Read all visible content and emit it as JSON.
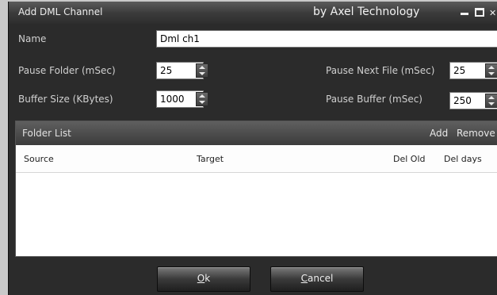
{
  "window": {
    "title": "Add DML Channel",
    "brand": "by Axel Technology"
  },
  "form": {
    "name_label": "Name",
    "name_value": "Dml ch1",
    "pause_folder_label": "Pause Folder (mSec)",
    "pause_folder_value": "25",
    "buffer_size_label": "Buffer Size (KBytes)",
    "buffer_size_value": "1000",
    "pause_next_file_label": "Pause Next File (mSec)",
    "pause_next_file_value": "25",
    "pause_buffer_label": "Pause Buffer (mSec)",
    "pause_buffer_value": "250"
  },
  "folder_list": {
    "title": "Folder List",
    "add_label": "Add",
    "remove_label": "Remove",
    "columns": [
      "Source",
      "Target",
      "Del Old",
      "Del days"
    ],
    "rows": []
  },
  "buttons": {
    "ok_mnemonic": "O",
    "ok_rest": "k",
    "cancel_mnemonic": "C",
    "cancel_rest": "ancel"
  },
  "icons": {
    "minimize": "minimize-icon",
    "maximize": "maximize-icon",
    "close": "close-icon",
    "spinner": "spinner-icon"
  },
  "colors": {
    "window_bg": "#2b2b2b",
    "titlebar": "#3c3c3c",
    "label_text": "#d0d0d0",
    "page_bg": "#c9c9c9"
  }
}
